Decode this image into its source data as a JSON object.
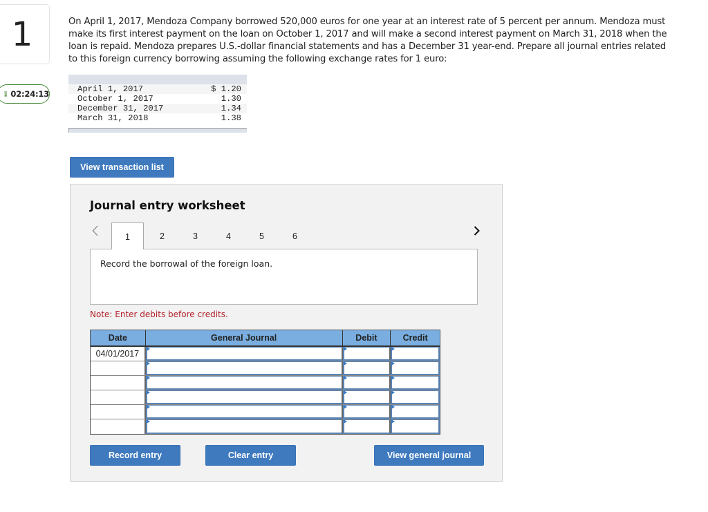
{
  "question": {
    "number": "1",
    "timer": "02:24:13",
    "text": "On April 1, 2017, Mendoza Company borrowed 520,000 euros for one year at an interest rate of 5 percent per annum. Mendoza must make its first interest payment on the loan on October 1, 2017 and will make a second interest payment on March 31, 2018 when the loan is repaid. Mendoza prepares U.S.-dollar financial statements and has a December 31 year-end. Prepare all journal entries related to this foreign currency borrowing assuming the following exchange rates for 1 euro:"
  },
  "exchange_rates": [
    {
      "date": "April 1, 2017",
      "rate": "$ 1.20"
    },
    {
      "date": "October 1, 2017",
      "rate": "1.30"
    },
    {
      "date": "December 31, 2017",
      "rate": "1.34"
    },
    {
      "date": "March 31, 2018",
      "rate": "1.38"
    }
  ],
  "buttons": {
    "view_transaction_list": "View transaction list",
    "record_entry": "Record entry",
    "clear_entry": "Clear entry",
    "view_general_journal": "View general journal"
  },
  "worksheet": {
    "title": "Journal entry worksheet",
    "tabs": [
      "1",
      "2",
      "3",
      "4",
      "5",
      "6"
    ],
    "active_tab": "1",
    "description": "Record the borrowal of the foreign loan.",
    "note": "Note: Enter debits before credits.",
    "columns": [
      "Date",
      "General Journal",
      "Debit",
      "Credit"
    ],
    "rows": [
      {
        "date": "04/01/2017",
        "account": "",
        "debit": "",
        "credit": ""
      },
      {
        "date": "",
        "account": "",
        "debit": "",
        "credit": ""
      },
      {
        "date": "",
        "account": "",
        "debit": "",
        "credit": ""
      },
      {
        "date": "",
        "account": "",
        "debit": "",
        "credit": ""
      },
      {
        "date": "",
        "account": "",
        "debit": "",
        "credit": ""
      },
      {
        "date": "",
        "account": "",
        "debit": "",
        "credit": ""
      }
    ]
  },
  "colors": {
    "button_blue": "#3f7abf",
    "header_blue": "#7aaee0",
    "note_red": "#b3202a",
    "timer_green": "#4a8a3a"
  }
}
